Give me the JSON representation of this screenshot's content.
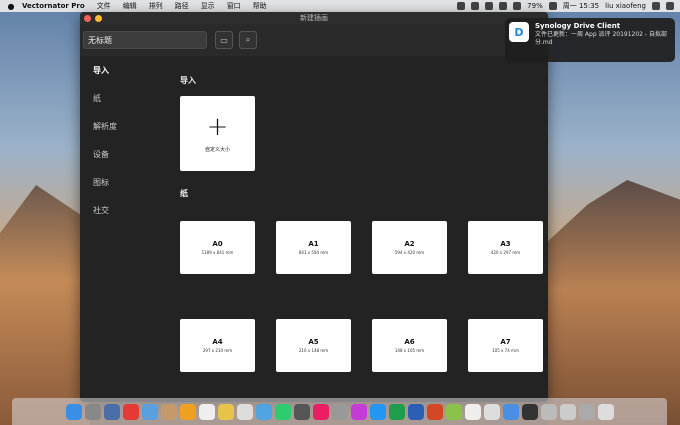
{
  "menubar": {
    "app": "Vectornator Pro",
    "items": [
      "文件",
      "编辑",
      "排列",
      "路径",
      "显示",
      "窗口",
      "帮助"
    ],
    "battery": "79%",
    "clock": "周一 15:35",
    "user": "liu xiaofeng"
  },
  "window": {
    "title": "新建插画",
    "doc_name": "无标题"
  },
  "sidebar": {
    "items": [
      {
        "label": "导入"
      },
      {
        "label": "纸"
      },
      {
        "label": "解析度"
      },
      {
        "label": "设备"
      },
      {
        "label": "图标"
      },
      {
        "label": "社交"
      }
    ]
  },
  "main": {
    "import_section": "导入",
    "custom_size": "自定义大小",
    "paper_section": "纸",
    "papers": [
      {
        "name": "A0",
        "size": "1189 x 841 mm"
      },
      {
        "name": "A1",
        "size": "841 x 594 mm"
      },
      {
        "name": "A2",
        "size": "594 x 420 mm"
      },
      {
        "name": "A3",
        "size": "420 x 297 mm"
      },
      {
        "name": "A4",
        "size": "297 x 210 mm"
      },
      {
        "name": "A5",
        "size": "210 x 148 mm"
      },
      {
        "name": "A6",
        "size": "148 x 105 mm"
      },
      {
        "name": "A7",
        "size": "105 x 74 mm"
      }
    ]
  },
  "notification": {
    "title": "Synology Drive Client",
    "body": "文件已更新：一周 App 派评 20191202 - 自拟部分.md"
  },
  "dock_colors": [
    "#3a8ee6",
    "#888",
    "#4a6fa8",
    "#e53935",
    "#5aa0e0",
    "#c49a6c",
    "#f0a020",
    "#eee",
    "#e8c34a",
    "#ddd",
    "#4fa3e0",
    "#2ecc71",
    "#555",
    "#e91e63",
    "#999",
    "#c43bd6",
    "#2196f3",
    "#1d9e4a",
    "#2b5fb5",
    "#d24726",
    "#8bc34a",
    "#eee",
    "#ddd",
    "#4a90e2",
    "#333",
    "#bbb",
    "#ccc",
    "#aaa",
    "#ddd"
  ]
}
